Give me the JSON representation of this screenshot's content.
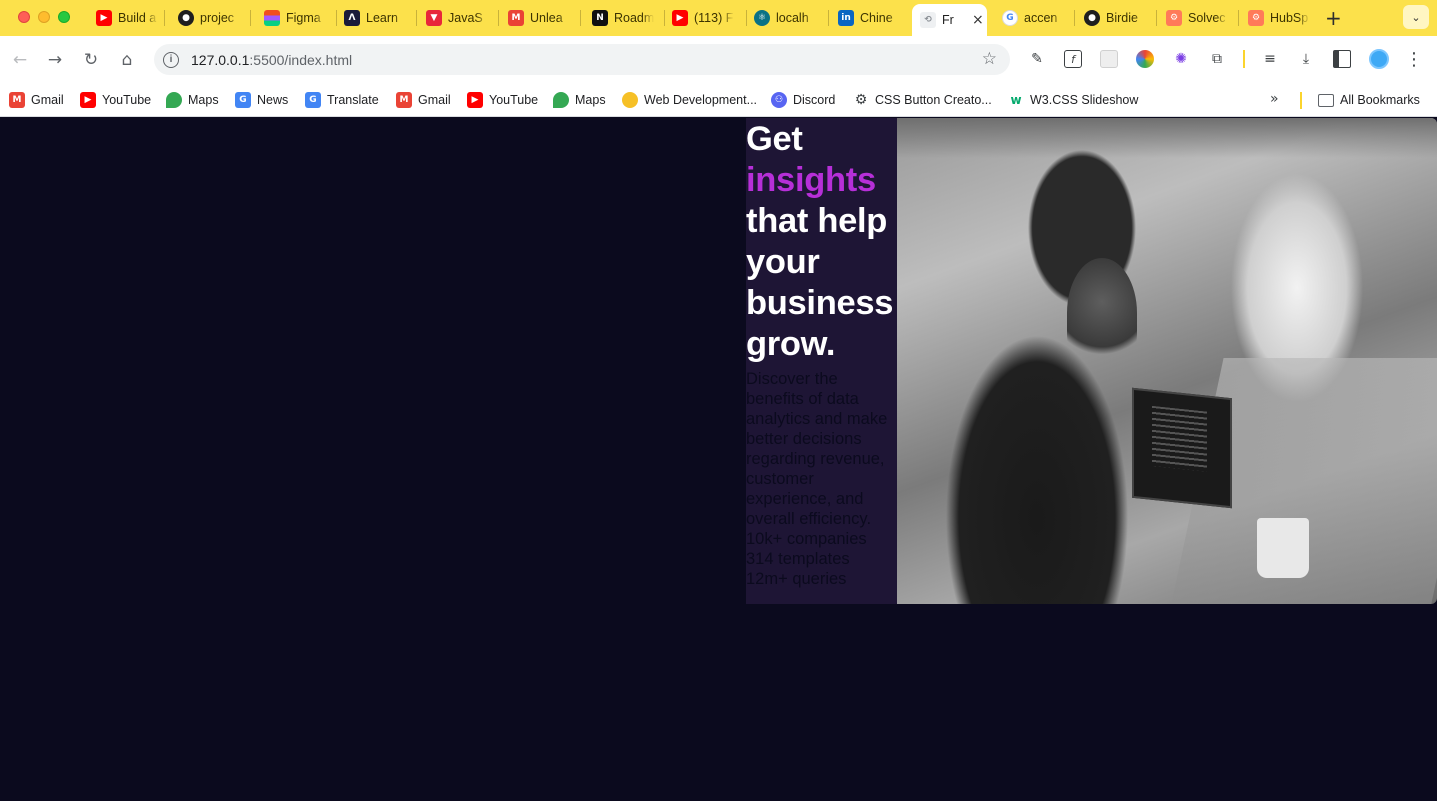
{
  "browser": {
    "tabs": [
      {
        "label": "Build a",
        "icon": "youtube-icon",
        "color": "#ff0000"
      },
      {
        "label": "projec",
        "icon": "github-icon",
        "color": "#1f1f1f"
      },
      {
        "label": "Figma",
        "icon": "figma-icon",
        "color": "#a259ff"
      },
      {
        "label": "Learn",
        "icon": "learn-icon",
        "color": "#1b1b3a"
      },
      {
        "label": "JavaS",
        "icon": "javascript-icon",
        "color": "#e8273a"
      },
      {
        "label": "Unlea",
        "icon": "gmail-icon",
        "color": "#ea4335"
      },
      {
        "label": "Roadm",
        "icon": "notion-icon",
        "color": "#111111"
      },
      {
        "label": "(113) F",
        "icon": "youtube-icon",
        "color": "#ff0000"
      },
      {
        "label": "localh",
        "icon": "react-icon",
        "color": "#0b7285"
      },
      {
        "label": "Chine",
        "icon": "linkedin-icon",
        "color": "#0a66c2"
      },
      {
        "label": "Fr",
        "icon": "page-icon",
        "color": "#9aa0a6",
        "active": true
      },
      {
        "label": "accen",
        "icon": "google-icon",
        "color": "#4285f4"
      },
      {
        "label": "Birdie",
        "icon": "github-icon",
        "color": "#1f1f1f"
      },
      {
        "label": "Solvec",
        "icon": "hubspot-icon",
        "color": "#ff7a59"
      },
      {
        "label": "HubSp",
        "icon": "hubspot-icon",
        "color": "#ff7a59"
      }
    ],
    "close_glyph": "×",
    "new_tab_glyph": "+",
    "tab_search_glyph": "⌄",
    "url_host": "127.0.0.1",
    "url_rest": ":5500/index.html",
    "nav": {
      "back": "←",
      "forward": "→",
      "reload": "↻",
      "home": "⌂"
    },
    "star_glyph": "☆",
    "extension_icons": [
      "eyedropper-icon",
      "fx-icon",
      "placeholder-icon",
      "color-wheel-icon",
      "gear-flower-icon",
      "puzzle-icon",
      "media-queue-icon",
      "download-icon",
      "sidepanel-icon"
    ],
    "menu_glyph": "⋮"
  },
  "bookmarks": [
    {
      "label": "Gmail",
      "icon": "gmail-icon",
      "color": "#ea4335"
    },
    {
      "label": "YouTube",
      "icon": "youtube-icon",
      "color": "#ff0000"
    },
    {
      "label": "Maps",
      "icon": "maps-icon",
      "color": "#34a853"
    },
    {
      "label": "News",
      "icon": "news-icon",
      "color": "#4285f4"
    },
    {
      "label": "Translate",
      "icon": "translate-icon",
      "color": "#4285f4"
    },
    {
      "label": "Gmail",
      "icon": "gmail-icon",
      "color": "#ea4335"
    },
    {
      "label": "YouTube",
      "icon": "youtube-icon",
      "color": "#ff0000"
    },
    {
      "label": "Maps",
      "icon": "maps-icon",
      "color": "#34a853"
    },
    {
      "label": "Web Development...",
      "icon": "lightbulb-icon",
      "color": "#f6c026"
    },
    {
      "label": "Discord",
      "icon": "discord-icon",
      "color": "#5865f2"
    },
    {
      "label": "CSS Button Creato...",
      "icon": "gear-icon",
      "color": "#3c4043"
    },
    {
      "label": "W3.CSS Slideshow",
      "icon": "w3-icon",
      "color": "#04aa6d"
    }
  ],
  "bookmarks_more": "»",
  "all_bookmarks": "All Bookmarks",
  "hero": {
    "headline_line1": "Get",
    "headline_accent": "insights",
    "headline_line3": "that help",
    "headline_line4": "your",
    "headline_line5": "business",
    "headline_line6": "grow.",
    "description": "Discover the benefits of data analytics and make better decisions regarding revenue, customer experience, and overall efficiency.",
    "stats": [
      "10k+ companies",
      "314 templates",
      "12m+ queries"
    ],
    "accent_color": "#b62fd8",
    "panel_color": "#1e1535",
    "page_bg": "#0b0a1e"
  }
}
